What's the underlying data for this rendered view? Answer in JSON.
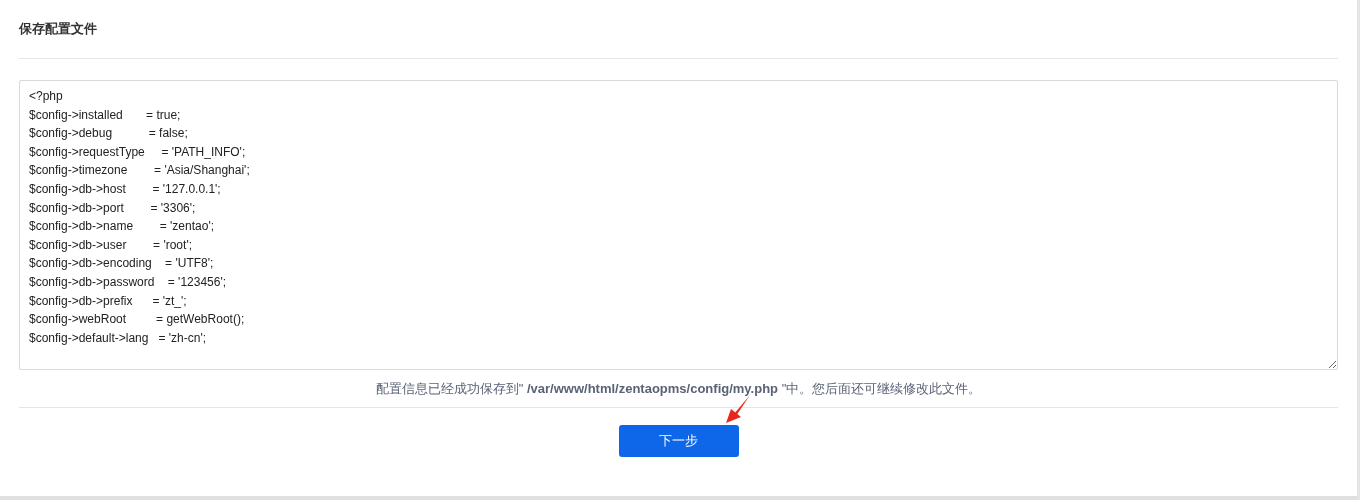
{
  "title": "保存配置文件",
  "config_file": {
    "lines": [
      "<?php",
      "$config->installed       = true;",
      "$config->debug           = false;",
      "$config->requestType     = 'PATH_INFO';",
      "$config->timezone        = 'Asia/Shanghai';",
      "$config->db->host        = '127.0.0.1';",
      "$config->db->port        = '3306';",
      "$config->db->name        = 'zentao';",
      "$config->db->user        = 'root';",
      "$config->db->encoding    = 'UTF8';",
      "$config->db->password    = '123456';",
      "$config->db->prefix      = 'zt_';",
      "$config->webRoot         = getWebRoot();",
      "$config->default->lang   = 'zh-cn';"
    ]
  },
  "message": "配置信息已经成功保存到\" **/var/www/html/zentaopms/config/my.php** \"中。您后面还可继续修改此文件。",
  "next_button": "下一步"
}
